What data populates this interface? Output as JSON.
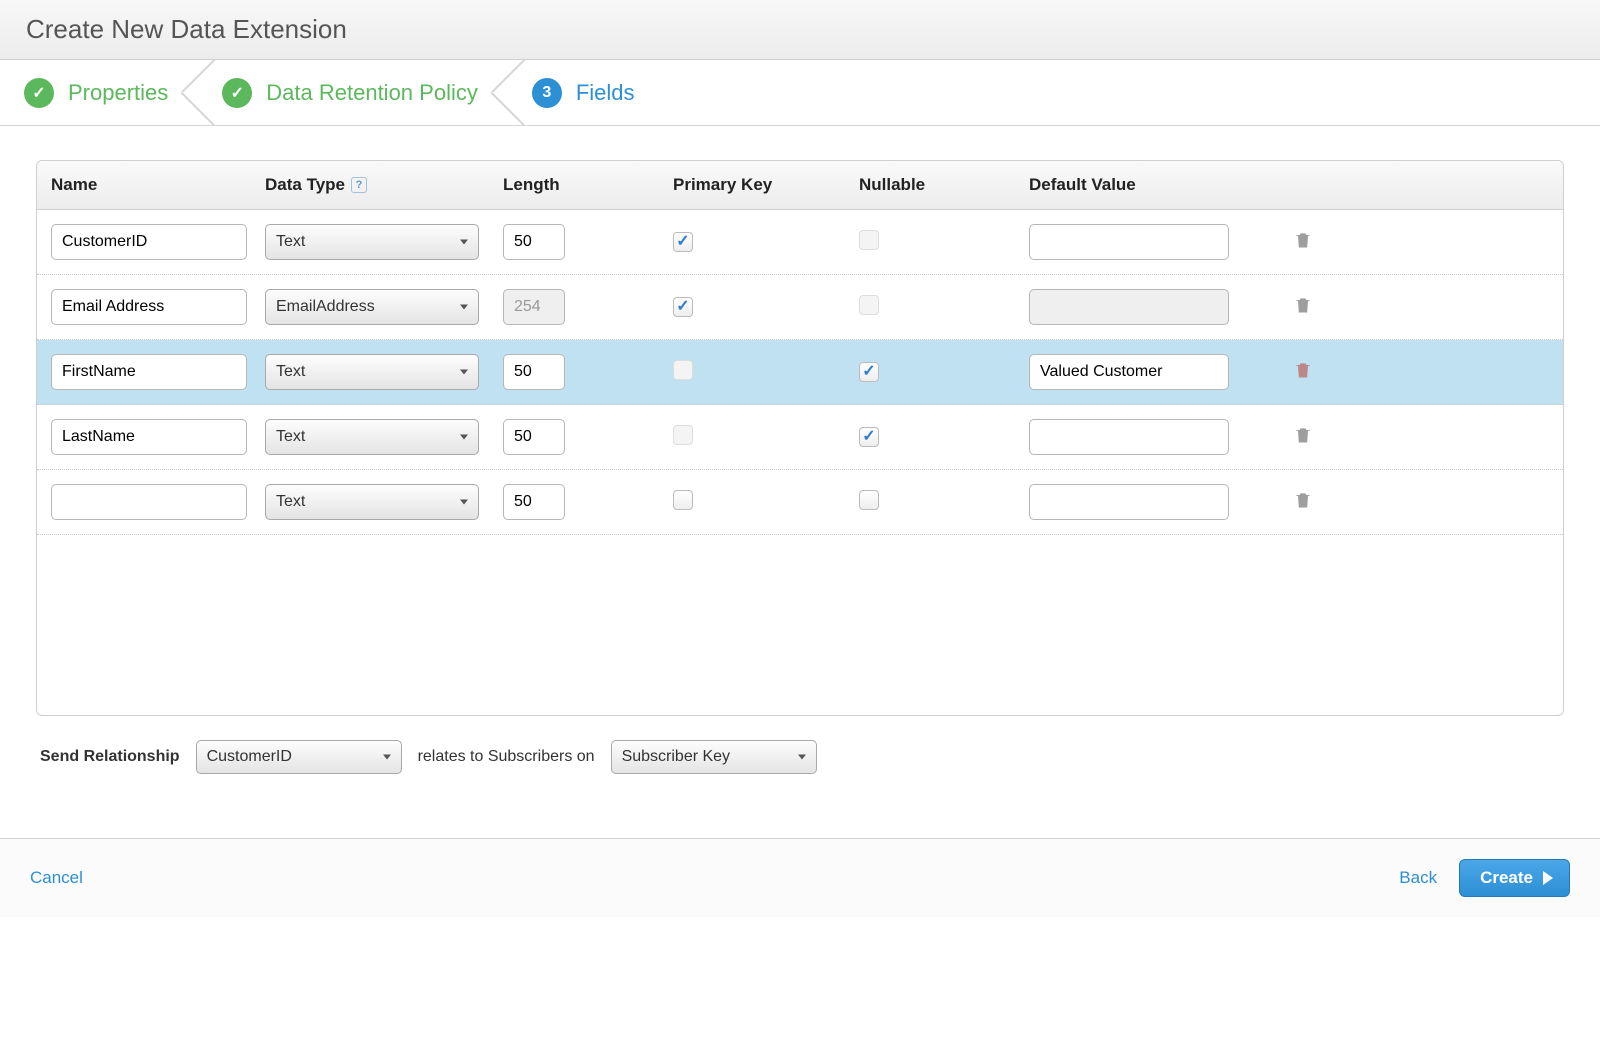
{
  "header": {
    "title": "Create New Data Extension"
  },
  "wizard": {
    "steps": [
      {
        "label": "Properties",
        "state": "done",
        "icon": "✓"
      },
      {
        "label": "Data Retention Policy",
        "state": "done",
        "icon": "✓"
      },
      {
        "label": "Fields",
        "state": "active",
        "icon": "3"
      }
    ]
  },
  "grid": {
    "headers": {
      "name": "Name",
      "data_type": "Data Type",
      "length": "Length",
      "primary_key": "Primary Key",
      "nullable": "Nullable",
      "default_value": "Default Value"
    },
    "rows": [
      {
        "name": "CustomerID",
        "type": "Text",
        "length": "50",
        "length_disabled": false,
        "pk": true,
        "pk_disabled": false,
        "nullable": false,
        "nullable_disabled": true,
        "default": "",
        "default_disabled": false,
        "selected": false
      },
      {
        "name": "Email Address",
        "type": "EmailAddress",
        "length": "254",
        "length_disabled": true,
        "pk": true,
        "pk_disabled": false,
        "nullable": false,
        "nullable_disabled": true,
        "default": "",
        "default_disabled": true,
        "selected": false
      },
      {
        "name": "FirstName",
        "type": "Text",
        "length": "50",
        "length_disabled": false,
        "pk": false,
        "pk_disabled": true,
        "nullable": true,
        "nullable_disabled": false,
        "default": "Valued Customer",
        "default_disabled": false,
        "selected": true
      },
      {
        "name": "LastName",
        "type": "Text",
        "length": "50",
        "length_disabled": false,
        "pk": false,
        "pk_disabled": true,
        "nullable": true,
        "nullable_disabled": false,
        "default": "",
        "default_disabled": false,
        "selected": false
      },
      {
        "name": "",
        "type": "Text",
        "length": "50",
        "length_disabled": false,
        "pk": false,
        "pk_disabled": false,
        "nullable": false,
        "nullable_disabled": false,
        "default": "",
        "default_disabled": false,
        "selected": false
      }
    ]
  },
  "relation": {
    "label": "Send Relationship",
    "field": "CustomerID",
    "middle_text": "relates to Subscribers on",
    "target": "Subscriber Key"
  },
  "footer": {
    "cancel": "Cancel",
    "back": "Back",
    "create": "Create"
  },
  "help_icon_text": "?"
}
